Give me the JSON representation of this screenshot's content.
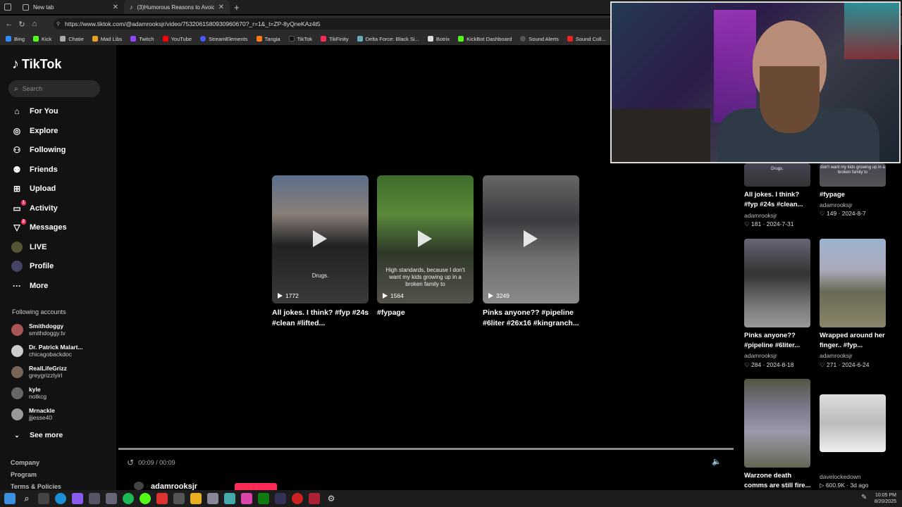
{
  "tabs": [
    {
      "label": "New tab"
    },
    {
      "label": "(3)Humorous Reasons to Avoid S..."
    }
  ],
  "url": "https://www.tiktok.com/@adamrooksjr/video/7532061580930960670?_r=1&_t=ZP-8yQneKAz4t5",
  "bookmarks": [
    "Bing",
    "Kick",
    "Chatie",
    "Mad Libs",
    "Twitch",
    "YouTube",
    "StreamElements",
    "Tangia",
    "TikTok",
    "TikFinity",
    "Delta Force: Black Si...",
    "Botrix",
    "KickBot Dashboard",
    "Sound Alerts",
    "Sound Coll..."
  ],
  "brand": {
    "name": "TikTok",
    "accent": "#fe2c55"
  },
  "search": {
    "placeholder": "Search"
  },
  "nav": [
    {
      "label": "For You",
      "icon": "home-icon"
    },
    {
      "label": "Explore",
      "icon": "compass-icon"
    },
    {
      "label": "Following",
      "icon": "following-icon"
    },
    {
      "label": "Friends",
      "icon": "friends-icon"
    },
    {
      "label": "Upload",
      "icon": "upload-icon"
    },
    {
      "label": "Activity",
      "icon": "activity-icon",
      "badge": "1"
    },
    {
      "label": "Messages",
      "icon": "messages-icon",
      "badge": "2"
    },
    {
      "label": "LIVE",
      "icon": "live-icon"
    },
    {
      "label": "Profile",
      "icon": "profile-icon"
    },
    {
      "label": "More",
      "icon": "more-icon"
    }
  ],
  "following_title": "Following accounts",
  "accounts": [
    {
      "name": "Smithdoggy",
      "handle": "smithdoggy.tv"
    },
    {
      "name": "Dr. Patrick Malart...",
      "handle": "chicagobackdoc"
    },
    {
      "name": "RealLifeGrizz",
      "handle": "greygrizzlyirl"
    },
    {
      "name": "kyle",
      "handle": "notkcg"
    },
    {
      "name": "Mrnackle",
      "handle": "jjjesse40"
    }
  ],
  "see_more": "See more",
  "footer": [
    "Company",
    "Program",
    "Terms & Policies"
  ],
  "videos": [
    {
      "count": "1772",
      "overlay": "Drugs.",
      "caption": "All jokes. I think? #fyp #24s #clean #lifted..."
    },
    {
      "count": "1564",
      "overlay": "High standards, because I don't want my kids growing up in a broken family to",
      "caption": "#fypage"
    },
    {
      "count": "3249",
      "overlay": "",
      "caption": "Pinks anyone?? #pipeline #6liter #26x16 #kingranch..."
    }
  ],
  "player": {
    "time": "00:09 / 00:09",
    "progress": 1.0,
    "author": "adamrooksjr"
  },
  "right": [
    {
      "overlay": "Drugs.",
      "caption": "All jokes. I think? #fyp #24s #clean...",
      "author": "adamrooksjr",
      "likes": "181",
      "date": "2024-7-31"
    },
    {
      "overlay": "don't want my kids growing up in a broken family to",
      "caption": "#fypage",
      "author": "adamrooksjr",
      "likes": "149",
      "date": "2024-8-7"
    },
    {
      "overlay": "",
      "caption": "Pinks anyone?? #pipeline #6liter...",
      "author": "adamrooksjr",
      "likes": "284",
      "date": "2024-8-18"
    },
    {
      "overlay": "",
      "caption": "Wrapped around her finger.. #fyp...",
      "author": "adamrooksjr",
      "likes": "271",
      "date": "2024-6-24"
    },
    {
      "overlay": "",
      "caption": "Warzone death comms are still fire...",
      "author": "",
      "likes": "",
      "date": ""
    },
    {
      "overlay": "",
      "caption": "",
      "author": "davelockedown",
      "likes": "600.9K",
      "date": "3d ago"
    }
  ],
  "clock": {
    "time": "10:05 PM",
    "date": "8/20/2025"
  }
}
